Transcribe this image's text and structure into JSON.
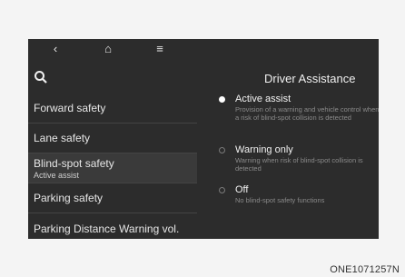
{
  "topbar": {
    "back_icon": "back-icon",
    "home_icon": "home-icon",
    "menu_icon": "menu-icon"
  },
  "search": {
    "icon": "search-icon"
  },
  "sidebar": {
    "items": [
      {
        "label": "Forward safety",
        "sub": ""
      },
      {
        "label": "Lane safety",
        "sub": ""
      },
      {
        "label": "Blind-spot safety",
        "sub": "Active assist"
      },
      {
        "label": "Parking safety",
        "sub": ""
      },
      {
        "label": "Parking Distance Warning vol.",
        "sub": ""
      }
    ]
  },
  "panel": {
    "title": "Driver Assistance",
    "options": [
      {
        "label": "Active assist",
        "desc": "Provision of a warning and vehicle control when a risk of blind-spot collision is detected",
        "selected": true
      },
      {
        "label": "Warning only",
        "desc": "Warning when risk of blind-spot collision is detected",
        "selected": false
      },
      {
        "label": "Off",
        "desc": "No blind-spot safety functions",
        "selected": false
      }
    ]
  },
  "caption": "ONE1071257N",
  "colors": {
    "screen_bg": "#2c2c2c",
    "text": "#e6e6e6",
    "desc": "#8a8a8a"
  }
}
